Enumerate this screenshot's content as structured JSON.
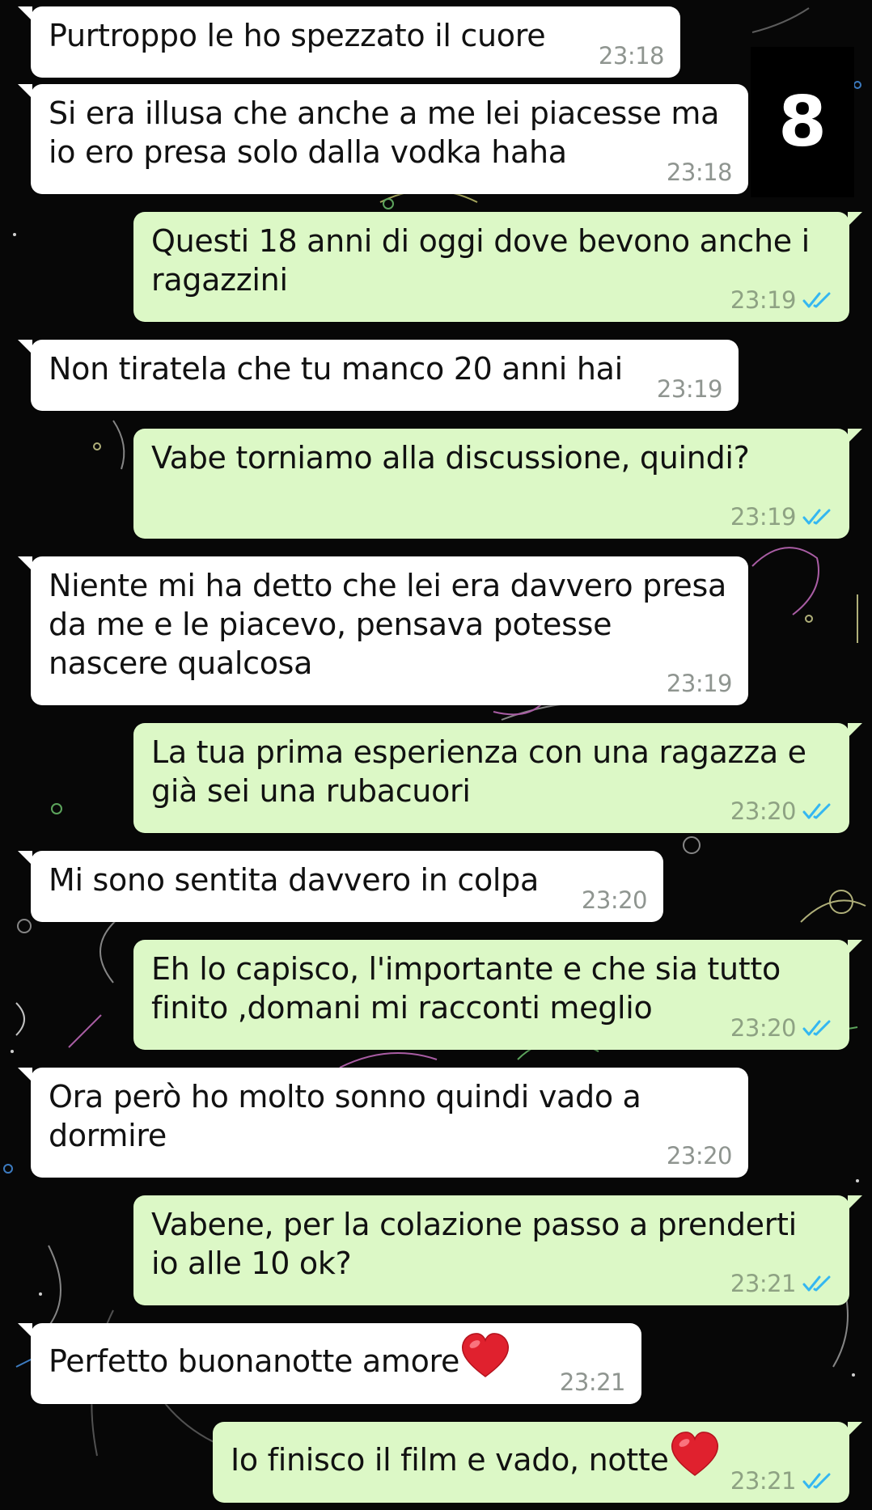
{
  "badge": {
    "label": "8"
  },
  "colors": {
    "incoming_bubble": "#ffffff",
    "outgoing_bubble": "#dcf8c6",
    "read_tick": "#34b7f1",
    "background": "#070707"
  },
  "messages": [
    {
      "direction": "in",
      "text": "Purtroppo le ho spezzato il cuore",
      "time": "23:18"
    },
    {
      "direction": "in",
      "text": "Si era illusa che anche a me lei piacesse ma io ero presa solo dalla vodka haha",
      "time": "23:18"
    },
    {
      "direction": "out",
      "text": "Questi 18 anni di oggi dove bevono anche i ragazzini",
      "time": "23:19",
      "status": "read"
    },
    {
      "direction": "in",
      "text": "Non tiratela che tu manco 20 anni hai",
      "time": "23:19"
    },
    {
      "direction": "out",
      "text": "Vabe torniamo alla discussione, quindi?",
      "time": "23:19",
      "status": "read"
    },
    {
      "direction": "in",
      "text": "Niente mi ha detto che lei era davvero presa da me e le piacevo, pensava potesse nascere qualcosa",
      "time": "23:19"
    },
    {
      "direction": "out",
      "text": "La tua prima esperienza con una ragazza e già sei una rubacuori",
      "time": "23:20",
      "status": "read"
    },
    {
      "direction": "in",
      "text": "Mi sono sentita davvero in colpa",
      "time": "23:20"
    },
    {
      "direction": "out",
      "text": "Eh lo capisco, l'importante e che sia tutto finito ,domani mi racconti meglio",
      "time": "23:20",
      "status": "read"
    },
    {
      "direction": "in",
      "text": "Ora però ho molto sonno quindi vado a dormire",
      "time": "23:20"
    },
    {
      "direction": "out",
      "text": "Vabene, per la colazione passo a prenderti io alle 10 ok?",
      "time": "23:21",
      "status": "read"
    },
    {
      "direction": "in",
      "text": "Perfetto buonanotte amore",
      "emoji": "heart-emoji-icon",
      "time": "23:21"
    },
    {
      "direction": "out",
      "text": "Io finisco il film e vado, notte",
      "emoji": "heart-emoji-icon",
      "time": "23:21",
      "status": "read"
    }
  ]
}
